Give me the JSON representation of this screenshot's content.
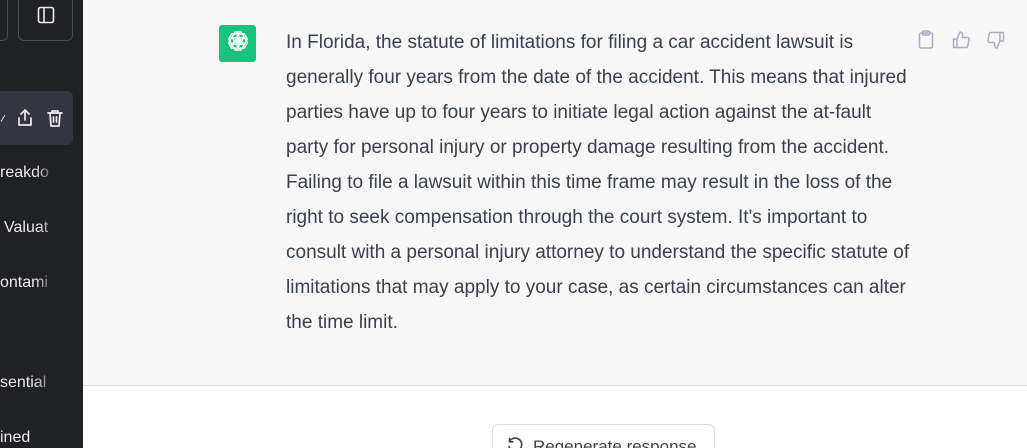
{
  "sidebar": {
    "chats": [
      {
        "label": "reakdo"
      },
      {
        "label": "Valuat"
      },
      {
        "label": "ontami"
      },
      {
        "label": "sential"
      },
      {
        "label": "ined"
      }
    ]
  },
  "message": {
    "text": "In Florida, the statute of limitations for filing a car accident lawsuit is generally four years from the date of the accident. This means that injured parties have up to four years to initiate legal action against the at-fault party for personal injury or property damage resulting from the accident. Failing to file a lawsuit within this time frame may result in the loss of the right to seek compensation through the court system. It's important to consult with a personal injury attorney to understand the specific statute of limitations that may apply to your case, as certain circumstances can alter the time limit."
  },
  "actions": {
    "regenerate_label": "Regenerate response"
  },
  "colors": {
    "sidebar_bg": "#202123",
    "message_bg": "#f7f7f8",
    "avatar_bg": "#19c37d",
    "text": "#374151"
  },
  "icons": [
    "sidebar-toggle-icon",
    "edit-icon",
    "share-icon",
    "trash-icon",
    "openai-logo-icon",
    "clipboard-icon",
    "thumbs-up-icon",
    "thumbs-down-icon",
    "regenerate-icon"
  ]
}
